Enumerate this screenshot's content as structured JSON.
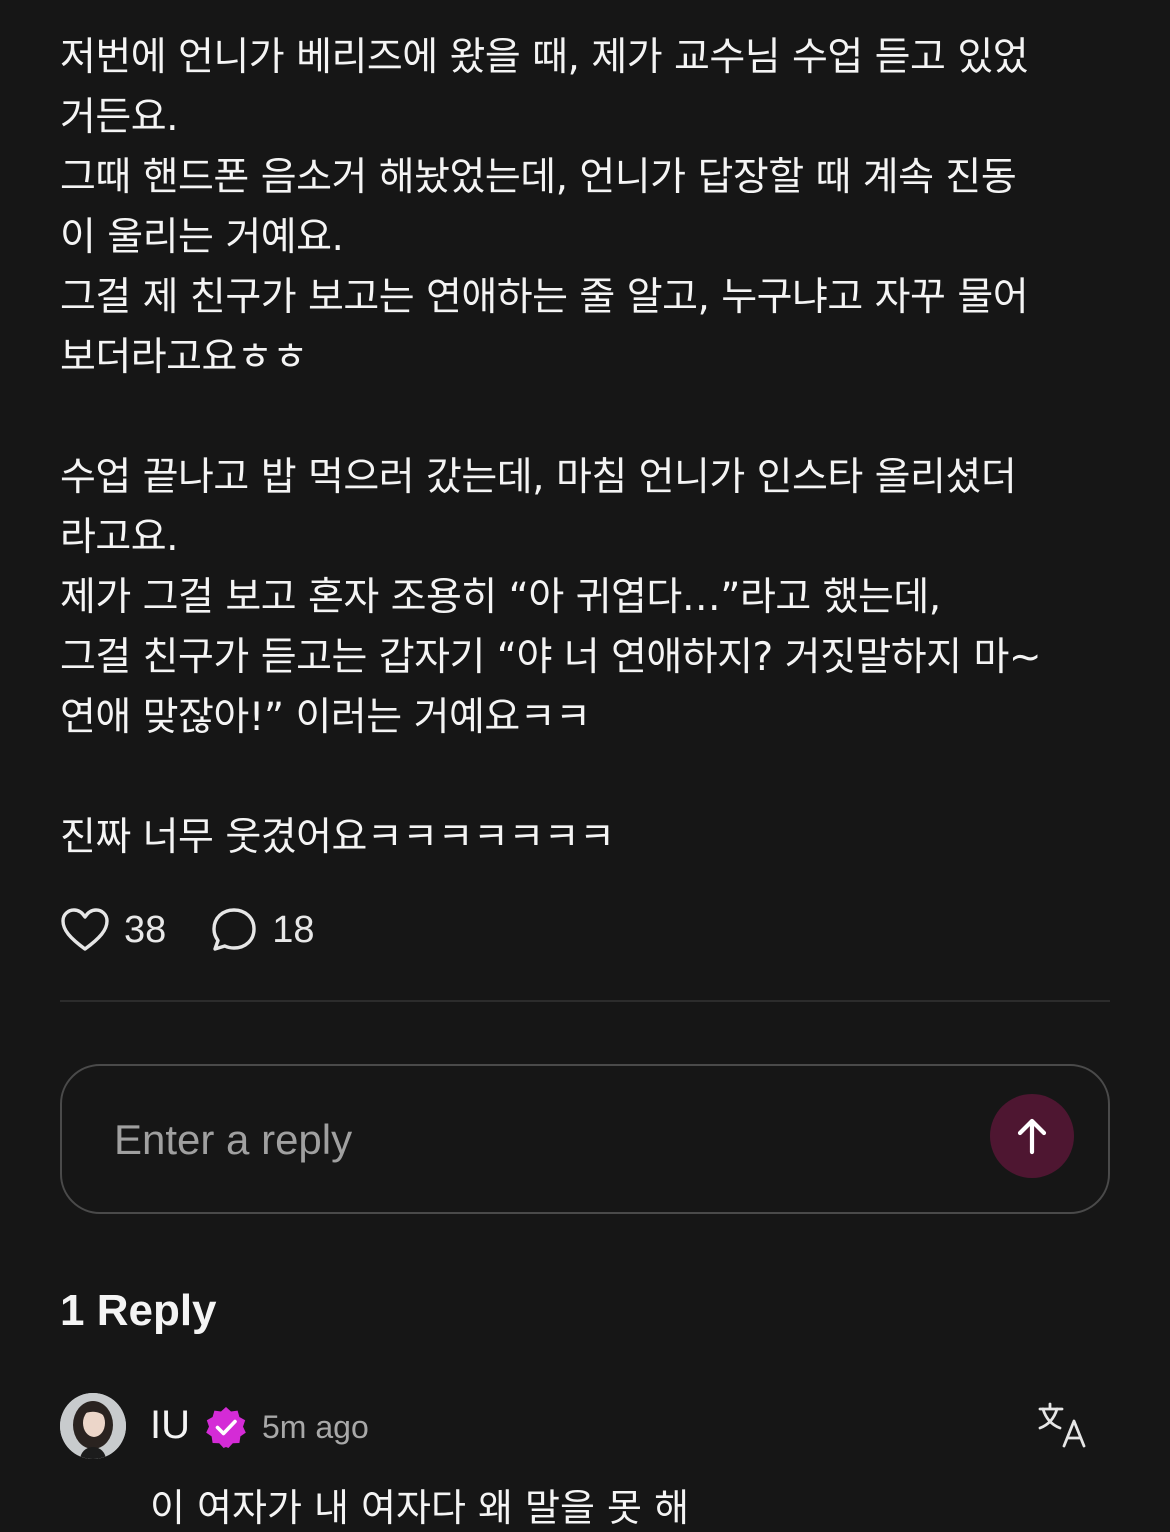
{
  "post": {
    "lines": [
      "저번에 언니가 베리즈에 왔을 때, 제가 교수님 수업 듣고 있었",
      "거든요.",
      "그때 핸드폰 음소거 해놨었는데, 언니가 답장할 때 계속 진동",
      "이 울리는 거예요.",
      "그걸 제 친구가 보고는 연애하는 줄 알고, 누구냐고 자꾸 물어",
      "보더라고요ㅎㅎ",
      "",
      "수업 끝나고 밥 먹으러 갔는데, 마침 언니가 인스타 올리셨더",
      "라고요.",
      "제가 그걸 보고 혼자 조용히 “아 귀엽다…”라고 했는데,",
      "그걸 친구가 듣고는 갑자기 “야 너 연애하지? 거짓말하지 마~",
      "연애 맞잖아!” 이러는 거예요ㅋㅋ",
      "",
      "진짜 너무 웃겼어요ㅋㅋㅋㅋㅋㅋㅋ"
    ]
  },
  "actions": {
    "likes": "38",
    "comments": "18",
    "like_icon": "heart-icon",
    "comment_icon": "speech-bubble-icon"
  },
  "reply_box": {
    "placeholder": "Enter a reply",
    "send_icon": "arrow-up-icon",
    "send_color": "#4e1631"
  },
  "replies": {
    "heading": "1 Reply",
    "items": [
      {
        "author": "IU",
        "verified_color": "#d42bd6",
        "time": "5m ago",
        "text": "이 여자가 내 여자다 왜 말을 못 해"
      }
    ]
  }
}
